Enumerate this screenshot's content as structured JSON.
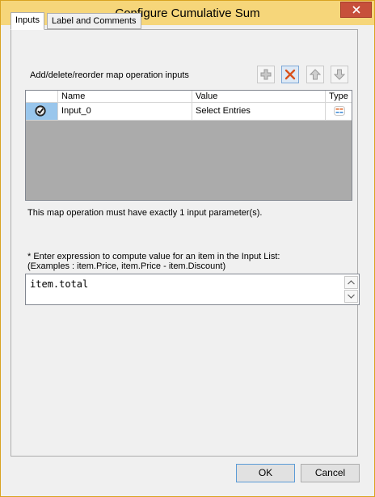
{
  "window": {
    "title": "Configure Cumulative Sum"
  },
  "tabs": [
    {
      "label": "Inputs",
      "selected": true
    },
    {
      "label": "Label and Comments",
      "selected": false
    }
  ],
  "inputs_tab": {
    "heading": "Add/delete/reorder map operation inputs",
    "toolbar": [
      {
        "icon": "add-icon",
        "tooltip": "Add"
      },
      {
        "icon": "delete-icon",
        "tooltip": "Delete"
      },
      {
        "icon": "move-up-icon",
        "tooltip": "Move Up"
      },
      {
        "icon": "move-down-icon",
        "tooltip": "Move Down"
      }
    ],
    "grid": {
      "columns": [
        "Name",
        "Value",
        "Type"
      ],
      "rows": [
        {
          "selected": true,
          "name": "Input_0",
          "value": "Select Entries",
          "type_icon": "list-type-icon"
        }
      ]
    },
    "constraint_text": "This map operation must have exactly 1 input parameter(s).",
    "expression_hint_line1": "* Enter expression to compute value for an item in the Input List:",
    "expression_hint_line2": "(Examples : item.Price, item.Price - item.Discount)",
    "expression_value": "item.total"
  },
  "buttons": {
    "ok": "OK",
    "cancel": "Cancel"
  },
  "colors": {
    "title_bar": "#f6d67a",
    "close_button": "#c7503b",
    "selected_row_indicator": "#99c6ec",
    "delete_icon": "#d9531e"
  }
}
